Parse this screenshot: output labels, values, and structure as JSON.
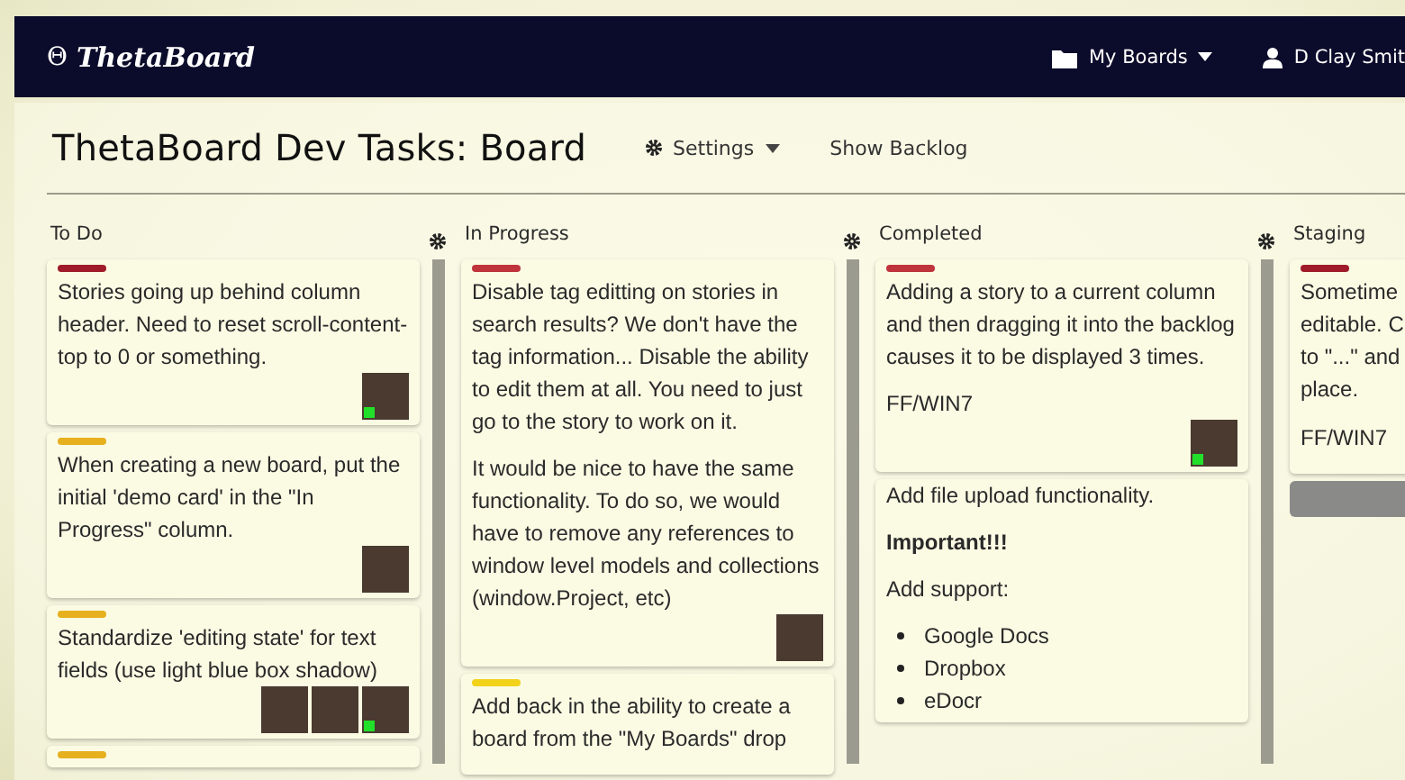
{
  "navbar": {
    "brand_symbol": "Θ",
    "brand": "ThetaBoard",
    "boards_menu": "My Boards",
    "user": "D Clay Smit"
  },
  "page": {
    "title": "ThetaBoard Dev Tasks: Board",
    "settings": "Settings",
    "show_backlog": "Show Backlog"
  },
  "columns": [
    {
      "name": "To Do",
      "cards": [
        {
          "color": "#a01c2a",
          "paragraphs": [
            {
              "kind": "text",
              "text": "Stories going up behind column header. Need to reset scroll-content-top to 0 or something."
            }
          ],
          "avatars": [
            {
              "online": true
            }
          ]
        },
        {
          "color": "#e6b01e",
          "paragraphs": [
            {
              "kind": "text",
              "text": "When creating a new board, put the initial 'demo card' in the \"In Progress\" column."
            }
          ],
          "avatars": [
            {
              "online": false
            }
          ]
        },
        {
          "color": "#e6b01e",
          "paragraphs": [
            {
              "kind": "text",
              "text": "Standardize 'editing state' for text fields (use light blue box shadow)"
            }
          ],
          "avatars": [
            {
              "online": false
            },
            {
              "online": false
            },
            {
              "online": true
            }
          ]
        },
        {
          "color": "#e6b01e"
        }
      ]
    },
    {
      "name": "In Progress",
      "cards": [
        {
          "color": "#c0343c",
          "paragraphs": [
            {
              "kind": "text",
              "text": "Disable tag editting on stories in search results? We don't have the tag information... Disable the ability to edit them at all. You need to just go to the story to work on it."
            },
            {
              "kind": "text",
              "text": "It would be nice to have the same functionality. To do so, we would have to remove any references to window level models and collections (window.Project, etc)"
            }
          ],
          "avatars": [
            {
              "online": false
            }
          ]
        },
        {
          "color": "#f2d21a",
          "paragraphs": [
            {
              "kind": "text",
              "text": "Add back in the ability to create a board from the \"My Boards\" drop"
            }
          ]
        }
      ]
    },
    {
      "name": "Completed",
      "cards": [
        {
          "color": "#c0343c",
          "paragraphs": [
            {
              "kind": "text",
              "text": "Adding a story to a current column and then dragging it into the backlog causes it to be displayed 3 times."
            },
            {
              "kind": "text",
              "text": "FF/WIN7"
            }
          ],
          "avatars": [
            {
              "online": true
            }
          ]
        },
        {
          "paragraphs": [
            {
              "kind": "text",
              "text": "Add file upload functionality."
            },
            {
              "kind": "bold",
              "text": "Important!!!"
            },
            {
              "kind": "text",
              "text": "Add support:"
            },
            {
              "kind": "bullets",
              "items": [
                "Google Docs",
                "Dropbox",
                "eDocr"
              ]
            }
          ]
        }
      ]
    },
    {
      "name": "Staging",
      "cards": [
        {
          "color": "#a01c2a",
          "paragraphs": [
            {
              "kind": "lines",
              "lines": [
                "Sometime",
                "editable. C",
                "to \"...\" and",
                "place."
              ]
            },
            {
              "kind": "text",
              "text": "FF/WIN7"
            }
          ]
        }
      ],
      "placeholder_bar": true
    }
  ]
}
